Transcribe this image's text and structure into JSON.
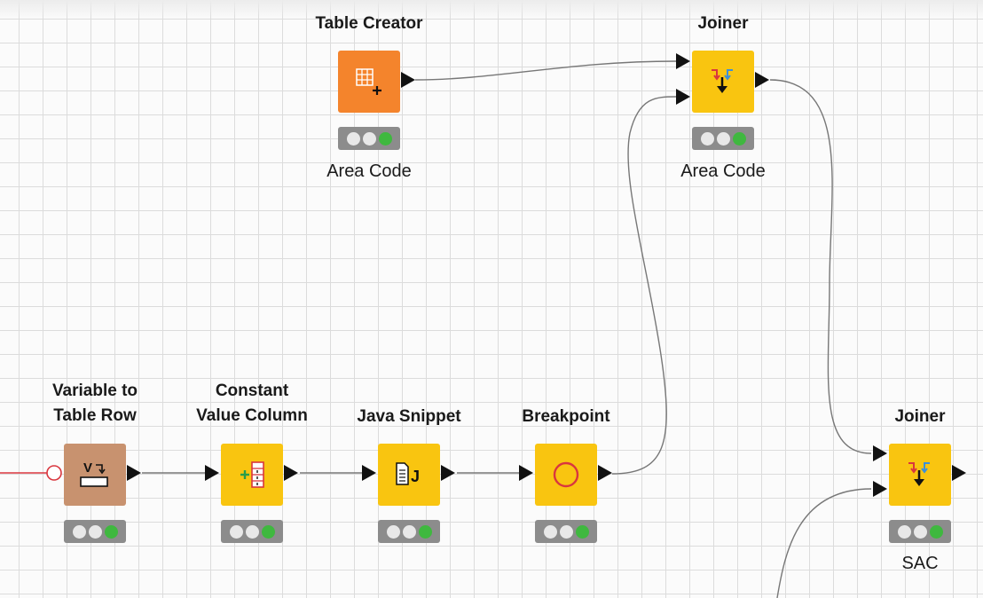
{
  "nodes": [
    {
      "id": "table-creator",
      "title": [
        "Table Creator"
      ],
      "label": "Area Code",
      "color": "orange",
      "icon": "table-plus-icon"
    },
    {
      "id": "joiner-top",
      "title": [
        "Joiner"
      ],
      "label": "Area Code",
      "color": "yellow",
      "icon": "joiner-icon"
    },
    {
      "id": "variable-to-table-row",
      "title": [
        "Variable to",
        "Table Row"
      ],
      "label": "",
      "color": "brown",
      "icon": "variable-to-row-icon"
    },
    {
      "id": "constant-value-column",
      "title": [
        "Constant",
        "Value Column"
      ],
      "label": "",
      "color": "yellow",
      "icon": "add-column-icon"
    },
    {
      "id": "java-snippet",
      "title": [
        "Java Snippet"
      ],
      "label": "",
      "color": "yellow",
      "icon": "java-snippet-icon"
    },
    {
      "id": "breakpoint",
      "title": [
        "Breakpoint"
      ],
      "label": "",
      "color": "yellow",
      "icon": "breakpoint-icon"
    },
    {
      "id": "joiner-bottom",
      "title": [
        "Joiner"
      ],
      "label": "SAC",
      "color": "yellow",
      "icon": "joiner-icon"
    }
  ],
  "colors": {
    "orange": "#f4842c",
    "yellow": "#f9c510",
    "brown": "#c8926f",
    "status_green": "#3fb83f",
    "flow_variable_red": "#d9363e"
  }
}
